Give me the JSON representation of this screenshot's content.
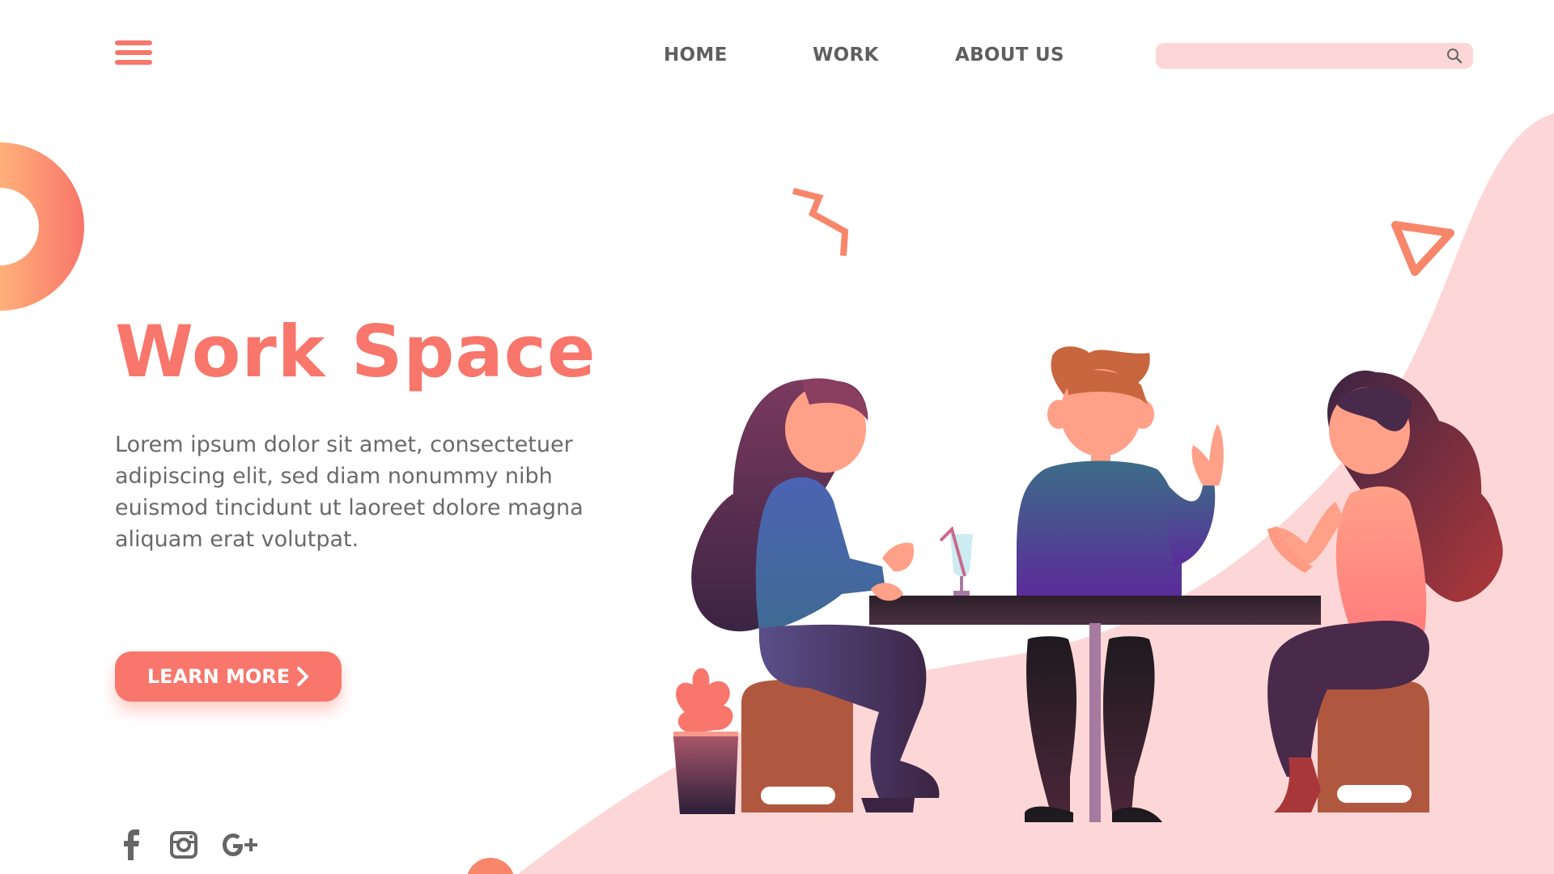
{
  "header": {
    "menu_icon": "hamburger-menu-icon",
    "nav": [
      {
        "label": "HOME"
      },
      {
        "label": "WORK"
      },
      {
        "label": "ABOUT US"
      }
    ],
    "search": {
      "placeholder": "",
      "value": "",
      "icon": "search-icon"
    }
  },
  "hero": {
    "title": "Work Space",
    "body": "Lorem ipsum dolor sit amet, consectetuer adipiscing elit, sed diam nonummy nibh euismod tincidunt ut laoreet dolore magna aliquam erat volutpat.",
    "cta_label": "LEARN MORE",
    "cta_icon": "chevron-right-icon"
  },
  "social": [
    {
      "icon": "facebook-icon"
    },
    {
      "icon": "instagram-icon"
    },
    {
      "icon": "google-plus-icon"
    }
  ],
  "colors": {
    "accent": "#f8766b",
    "nav_text": "#5f5f5f",
    "body_text": "#6a6a6a",
    "blob": "#fdd7d7"
  }
}
